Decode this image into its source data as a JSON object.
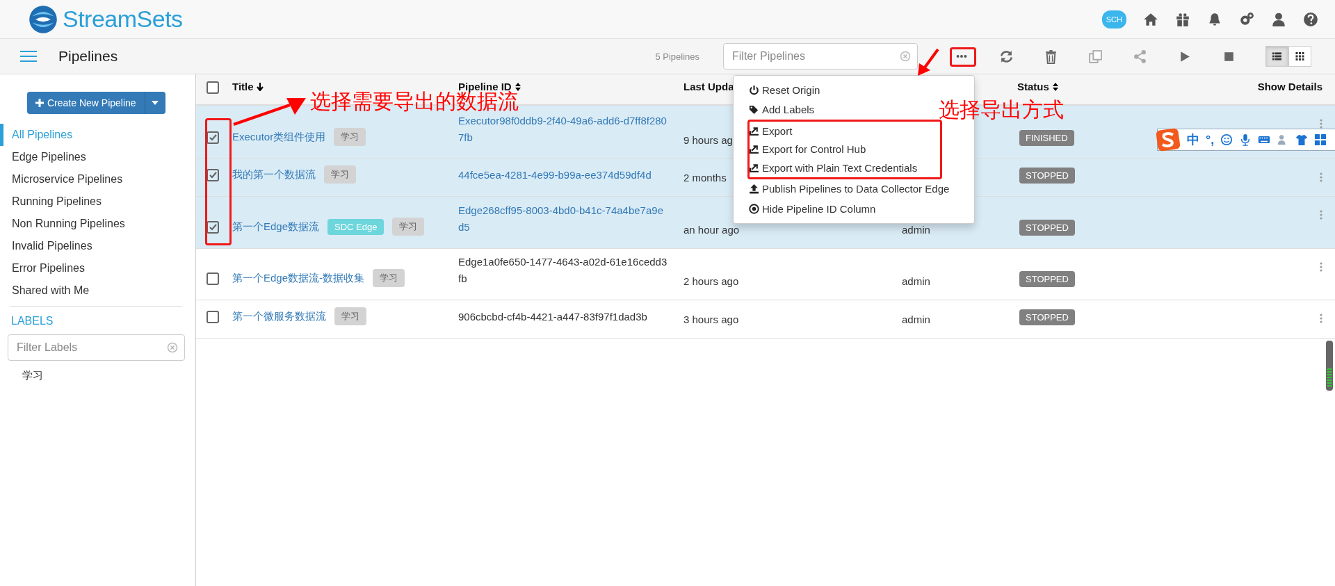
{
  "header": {
    "logo": "StreamSets",
    "cloud_badge": "SCH"
  },
  "toolbar": {
    "title": "Pipelines",
    "count": "5 Pipelines",
    "filter": {
      "placeholder": "Filter Pipelines"
    }
  },
  "sidebar": {
    "create_button": "Create New Pipeline",
    "items": [
      {
        "label": "All Pipelines",
        "selected": true
      },
      {
        "label": "Edge Pipelines",
        "selected": false
      },
      {
        "label": "Microservice Pipelines",
        "selected": false
      },
      {
        "label": "Running Pipelines",
        "selected": false
      },
      {
        "label": "Non Running Pipelines",
        "selected": false
      },
      {
        "label": "Invalid Pipelines",
        "selected": false
      },
      {
        "label": "Error Pipelines",
        "selected": false
      },
      {
        "label": "Shared with Me",
        "selected": false
      }
    ],
    "labels_heading": "LABELS",
    "labels_filter": {
      "placeholder": "Filter Labels"
    },
    "labels": [
      "学习"
    ]
  },
  "table": {
    "select_all": {
      "checked": false
    },
    "columns": [
      "Title",
      "Pipeline ID",
      "Last Upda",
      "Status",
      "Show Details"
    ],
    "rows": [
      {
        "selected": true,
        "title": "Executor类组件使用",
        "tags": [
          {
            "text": "学习",
            "color": "#d3d3d3"
          }
        ],
        "pipeline_id": "Executor98f0ddb9-2f40-49a6-add6-d7ff8f2807fb",
        "last_updated": "9 hours ag",
        "status": "FINISHED"
      },
      {
        "selected": true,
        "title": "我的第一个数据流",
        "tags": [
          {
            "text": "学习",
            "color": "#d3d3d3"
          }
        ],
        "pipeline_id": "44fce5ea-4281-4e99-b99a-ee374d59df4d",
        "last_updated": "2 months",
        "status": "STOPPED"
      },
      {
        "selected": true,
        "title": "第一个Edge数据流",
        "tags": [
          {
            "text": "SDC Edge",
            "color": "#6cd6dc"
          },
          {
            "text": "学习",
            "color": "#d3d3d3"
          }
        ],
        "pipeline_id": "Edge268cff95-8003-4bd0-b41c-74a4be7a9ed5",
        "last_updated": "an hour ago",
        "owner": "admin",
        "status": "STOPPED"
      },
      {
        "selected": false,
        "title": "第一个Edge数据流-数据收集",
        "tags": [
          {
            "text": "学习",
            "color": "#d3d3d3"
          }
        ],
        "pipeline_id": "Edge1a0fe650-1477-4643-a02d-61e16cedd3fb",
        "last_updated": "2 hours ago",
        "owner": "admin",
        "status": "STOPPED"
      },
      {
        "selected": false,
        "title": "第一个微服务数据流",
        "tags": [
          {
            "text": "学习",
            "color": "#d3d3d3"
          }
        ],
        "pipeline_id": "906cbcbd-cf4b-4421-a447-83f97f1dad3b",
        "last_updated": "3 hours ago",
        "owner": "admin",
        "status": "STOPPED"
      }
    ]
  },
  "more_menu": {
    "items": [
      {
        "kind": "power",
        "label": "Reset Origin"
      },
      {
        "kind": "tag",
        "label": "Add Labels"
      },
      {
        "kind": "export",
        "label": "Export"
      },
      {
        "kind": "export",
        "label": "Export for Control Hub"
      },
      {
        "kind": "export",
        "label": "Export with Plain Text Credentials"
      },
      {
        "kind": "upload",
        "label": "Publish Pipelines to Data Collector Edge"
      },
      {
        "kind": "target",
        "label": "Hide Pipeline ID Column"
      }
    ]
  },
  "annotations": [
    {
      "text": "选择需要导出的数据流"
    },
    {
      "text": "选择导出方式"
    }
  ],
  "ime_toolbar": {
    "mode": "中",
    "punctuation": "°,"
  }
}
